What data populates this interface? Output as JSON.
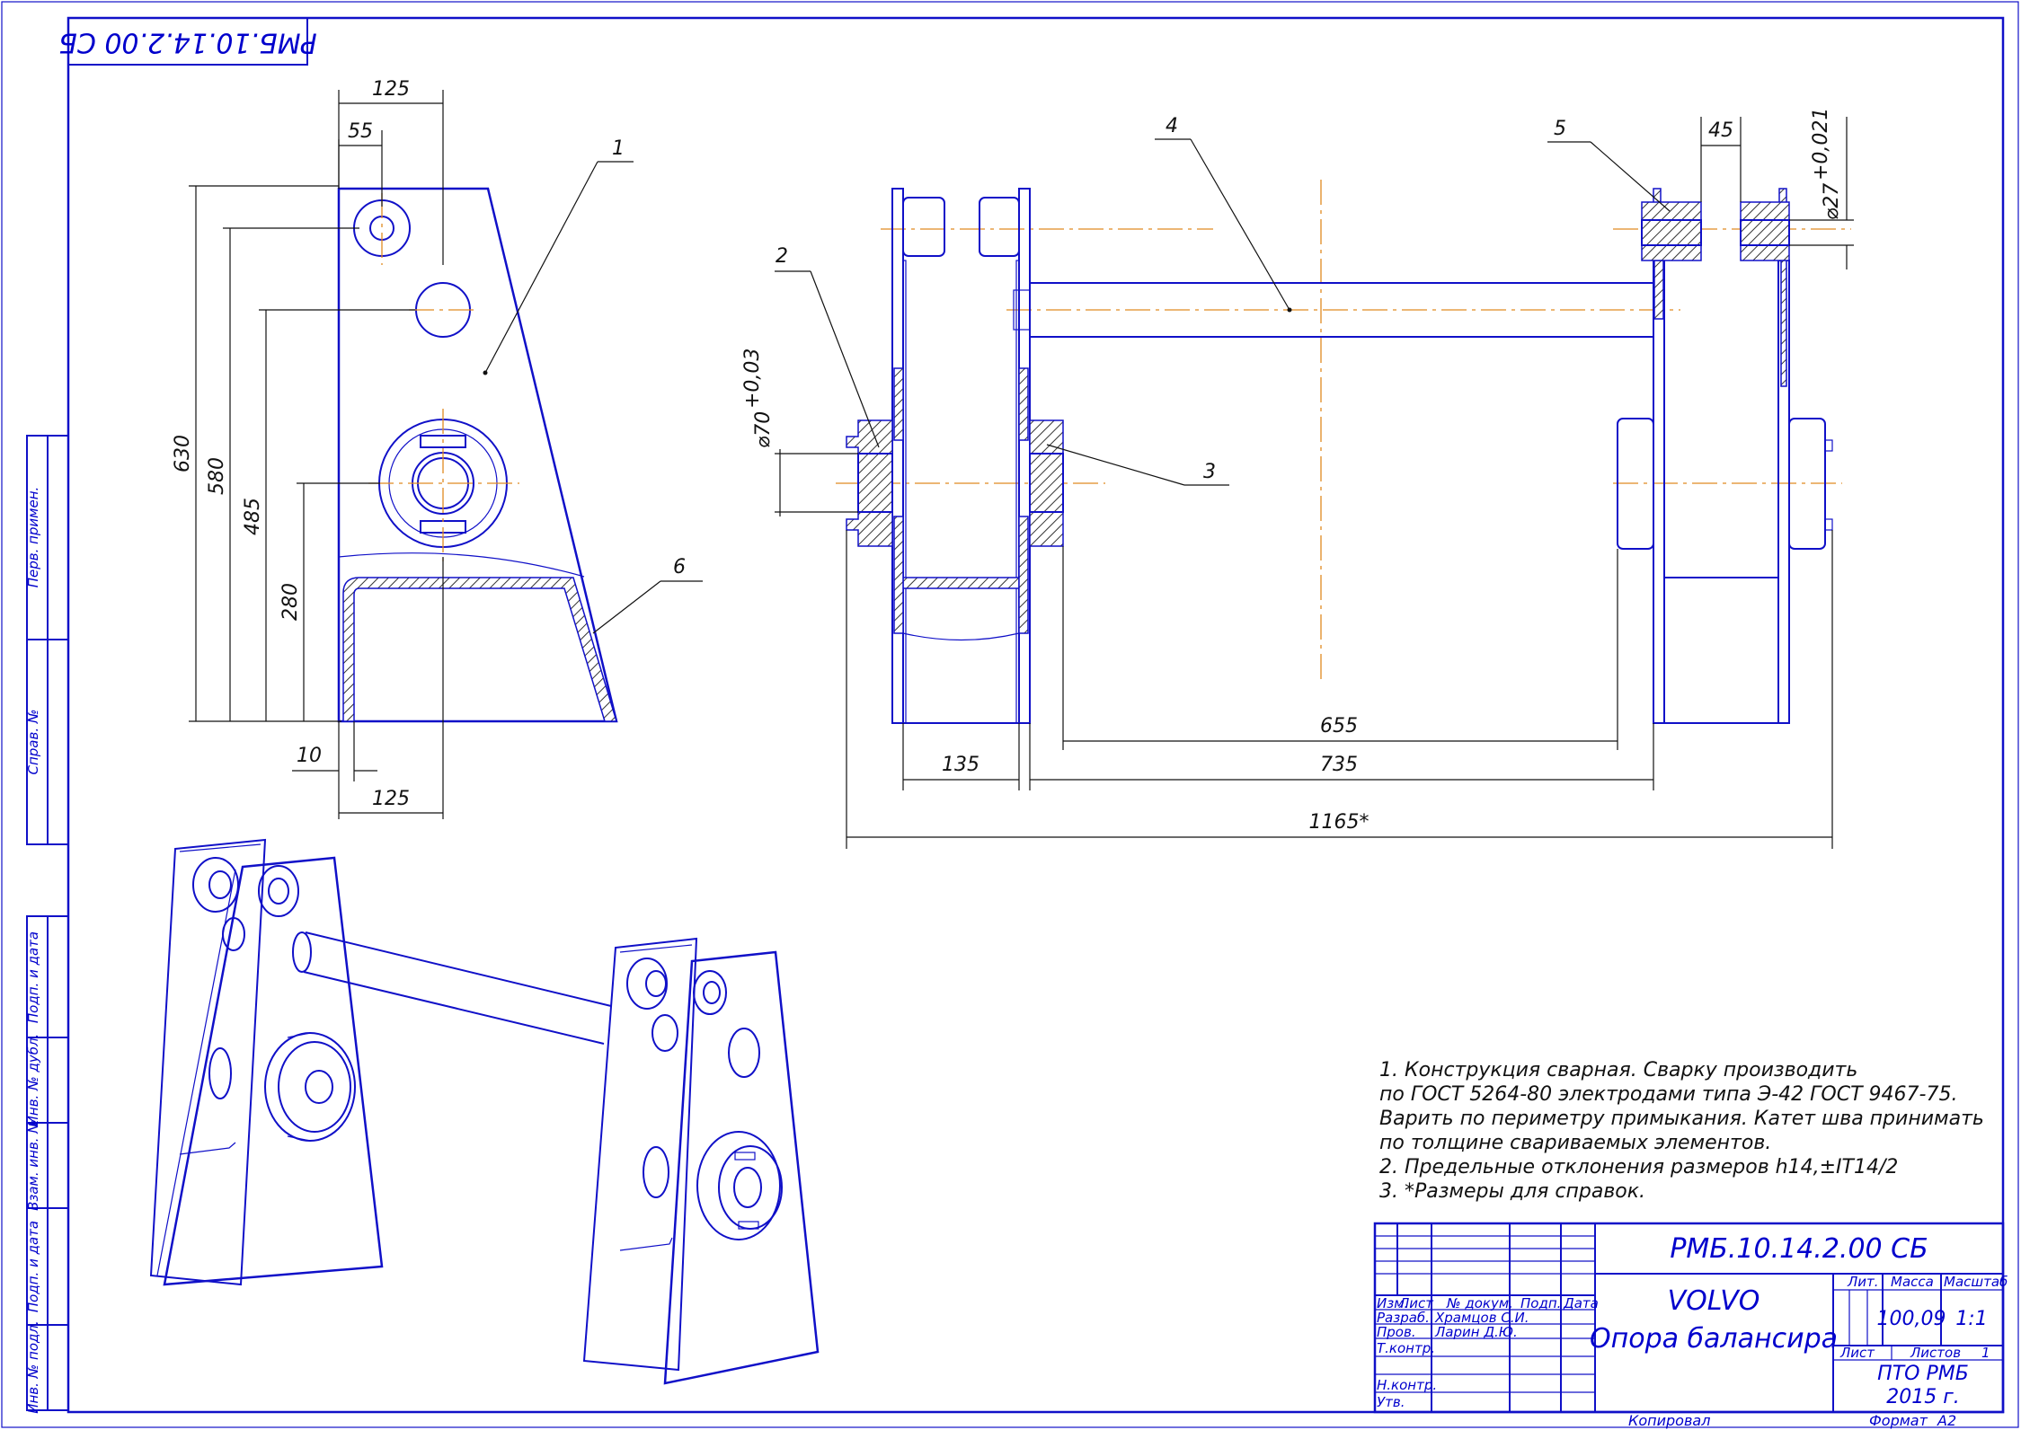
{
  "stamp": {
    "designation_rotated": "РМБ.10.14.2.00 СБ"
  },
  "side_strip": {
    "labels": [
      "Перв. примен.",
      "Справ. №",
      "Подп. и дата",
      "Инв. № дубл.",
      "Взам. инв. №",
      "Подп. и дата",
      "Инв. № подл."
    ]
  },
  "callouts": [
    "1",
    "2",
    "3",
    "4",
    "5",
    "6"
  ],
  "dimensions": {
    "side_view": {
      "d125_top": "125",
      "d55": "55",
      "d630": "630",
      "d580": "580",
      "d485": "485",
      "d280": "280",
      "d10": "10",
      "d125_bottom": "125"
    },
    "front_view": {
      "d45": "45",
      "phi27": "⌀27",
      "phi27_tol": "+0,021",
      "phi70": "⌀70",
      "phi70_tol": "+0,03",
      "d655": "655",
      "d135": "135",
      "d735": "735",
      "d1165": "1165*"
    }
  },
  "notes": [
    "1. Конструкция сварная. Сварку производить",
    "по ГОСТ 5264-80 электродами типа Э-42 ГОСТ 9467-75.",
    "Варить по периметру примыкания. Катет шва принимать",
    "по толщине свариваемых элементов.",
    "2. Предельные отклонения размеров h14,±IT14/2",
    "3. *Размеры для справок."
  ],
  "title_block": {
    "designation": "РМБ.10.14.2.00 СБ",
    "product": "VOLVO",
    "name": "Опора балансира",
    "col_headers": {
      "izm": "Изм.",
      "list": "Лист",
      "doc": "№ докум.",
      "sign": "Подп.",
      "date": "Дата"
    },
    "roles": {
      "razrab": "Разраб.",
      "prov": "Пров.",
      "tkontr": "Т.контр.",
      "nkontr": "Н.контр.",
      "utv": "Утв."
    },
    "names": {
      "razrab": "Храмцов С.И.",
      "prov": "Ларин Д.Ю."
    },
    "lit_label": "Лит.",
    "mass_label": "Масса",
    "scale_label": "Масштаб",
    "mass": "100,09",
    "scale": "1:1",
    "sheet_label": "Лист",
    "sheets_label": "Листов",
    "sheets": "1",
    "org": "ПТО РМБ",
    "year": "2015 г.",
    "copied": "Копировал",
    "format_label": "Формат",
    "format": "А2"
  }
}
